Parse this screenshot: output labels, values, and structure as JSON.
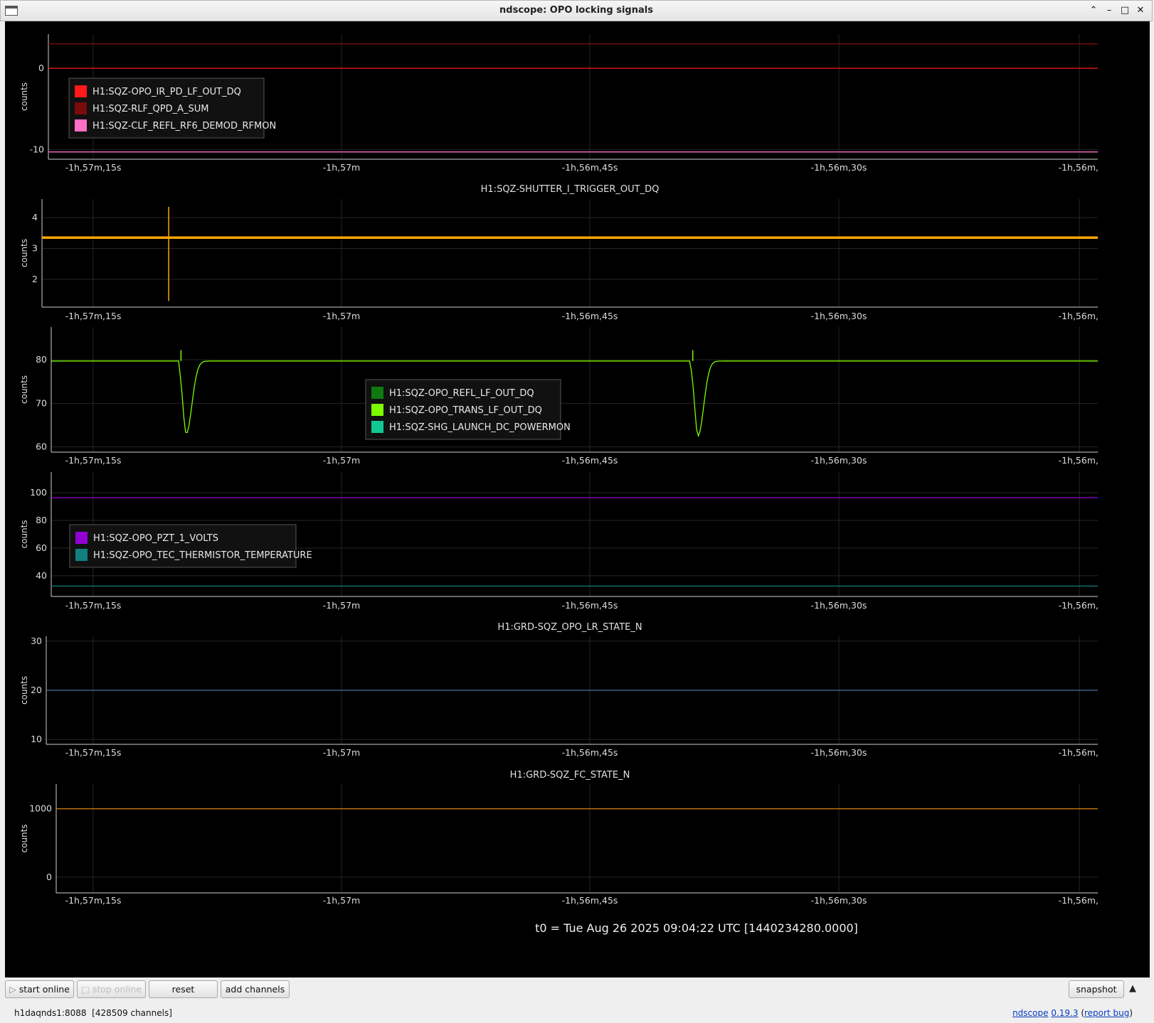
{
  "window": {
    "title": "ndscope: OPO locking signals"
  },
  "x_ticks": [
    "-1h,57m,15s",
    "-1h,57m",
    "-1h,56m,45s",
    "-1h,56m,30s",
    "-1h,56m,"
  ],
  "t0_label": "t0 = Tue Aug 26 2025 09:04:22 UTC [1440234280.0000]",
  "chart_data": [
    {
      "type": "line",
      "title": "",
      "ylabel": "counts",
      "ylim": [
        -11.2,
        4.2
      ],
      "yticks": [
        0,
        -10
      ],
      "x_ticks": [
        "-1h,57m,15s",
        "-1h,57m",
        "-1h,56m,45s",
        "-1h,56m,30s",
        "-1h,56m,"
      ],
      "legend": "upper-left",
      "series": [
        {
          "name": "H1:SQZ-OPO_IR_PD_LF_OUT_DQ",
          "color": "#ff1a1a",
          "level": 0
        },
        {
          "name": "H1:SQZ-RLF_QPD_A_SUM",
          "color": "#7a0b0b",
          "level": 3
        },
        {
          "name": "H1:SQZ-CLF_REFL_RF6_DEMOD_RFMON",
          "color": "#ff6ec7",
          "level": -10.3
        }
      ]
    },
    {
      "type": "line",
      "title": "H1:SQZ-SHUTTER_I_TRIGGER_OUT_DQ",
      "ylabel": "counts",
      "ylim": [
        1.1,
        4.6
      ],
      "yticks": [
        4,
        3,
        2
      ],
      "x_ticks": [
        "-1h,57m,15s",
        "-1h,57m",
        "-1h,56m,45s",
        "-1h,56m,30s",
        "-1h,56m,"
      ],
      "series": [
        {
          "name": "",
          "color": "#ffa500",
          "level": 3.35,
          "spike_at_frac": 0.12,
          "spike_range": [
            1.3,
            4.35
          ]
        }
      ]
    },
    {
      "type": "line",
      "title": "",
      "ylabel": "counts",
      "ylim": [
        58.8,
        87.5
      ],
      "yticks": [
        80,
        70,
        60
      ],
      "x_ticks": [
        "-1h,57m,15s",
        "-1h,57m",
        "-1h,56m,45s",
        "-1h,56m,30s",
        "-1h,56m,"
      ],
      "legend": "center",
      "series": [
        {
          "name": "H1:SQZ-OPO_REFL_LF_OUT_DQ",
          "color": "#0f7a0f"
        },
        {
          "name": "H1:SQZ-OPO_TRANS_LF_OUT_DQ",
          "color": "#7cfc00",
          "level": 79.7,
          "dips": [
            {
              "at_frac": 0.124,
              "min": 63
            },
            {
              "at_frac": 0.613,
              "min": 62.5
            }
          ]
        },
        {
          "name": "H1:SQZ-SHG_LAUNCH_DC_POWERMON",
          "color": "#12c993"
        }
      ]
    },
    {
      "type": "line",
      "title": "",
      "ylabel": "counts",
      "ylim": [
        25,
        115
      ],
      "yticks": [
        100,
        80,
        60,
        40
      ],
      "x_ticks": [
        "-1h,57m,15s",
        "-1h,57m",
        "-1h,56m,45s",
        "-1h,56m,30s",
        "-1h,56m,"
      ],
      "legend": "upper-left",
      "series": [
        {
          "name": "H1:SQZ-OPO_PZT_1_VOLTS",
          "color": "#9400d3",
          "level": 96.5
        },
        {
          "name": "H1:SQZ-OPO_TEC_THERMISTOR_TEMPERATURE",
          "color": "#108080",
          "level": 32.5
        }
      ]
    },
    {
      "type": "line",
      "title": "H1:GRD-SQZ_OPO_LR_STATE_N",
      "ylabel": "counts",
      "ylim": [
        9,
        31
      ],
      "yticks": [
        30,
        20,
        10
      ],
      "x_ticks": [
        "-1h,57m,15s",
        "-1h,57m",
        "-1h,56m,45s",
        "-1h,56m,30s",
        "-1h,56m,"
      ],
      "series": [
        {
          "name": "",
          "color": "#4a6fa5",
          "level": 20
        }
      ]
    },
    {
      "type": "line",
      "title": "H1:GRD-SQZ_FC_STATE_N",
      "ylabel": "counts",
      "ylim": [
        -230,
        1360
      ],
      "yticks": [
        1000,
        0
      ],
      "x_ticks": [
        "-1h,57m,15s",
        "-1h,57m",
        "-1h,56m,45s",
        "-1h,56m,30s",
        "-1h,56m,"
      ],
      "series": [
        {
          "name": "",
          "color": "#d2820f",
          "level": 1000
        }
      ]
    }
  ],
  "toolbar": {
    "start_online": "start online",
    "stop_online": "stop online",
    "reset": "reset",
    "add_channels": "add channels",
    "snapshot": "snapshot"
  },
  "status": {
    "server": "h1daqnds1:8088",
    "channels": "[428509 channels]",
    "app_name": "ndscope",
    "version": "0.19.3",
    "report_bug": "report bug"
  }
}
